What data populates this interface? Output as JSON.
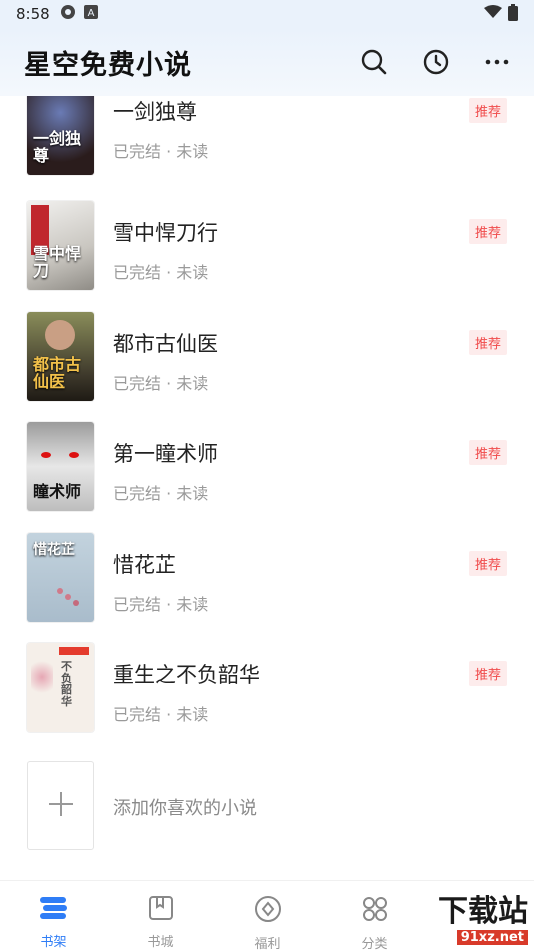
{
  "status_bar": {
    "time": "8:58"
  },
  "header": {
    "title": "星空免费小说"
  },
  "books": [
    {
      "title": "一剑独尊",
      "meta": "已完结 · 未读",
      "badge": "推荐",
      "cover_text": "一剑独尊",
      "cover_color": "#3b2a2a"
    },
    {
      "title": "雪中悍刀行",
      "meta": "已完结 · 未读",
      "badge": "推荐",
      "cover_text": "雪中悍刀",
      "cover_color": "#d8d6d2"
    },
    {
      "title": "都市古仙医",
      "meta": "已完结 · 未读",
      "badge": "推荐",
      "cover_text": "都市古仙医",
      "cover_color": "#5a5444"
    },
    {
      "title": "第一瞳术师",
      "meta": "已完结 · 未读",
      "badge": "推荐",
      "cover_text": "瞳术师",
      "cover_color": "#6b6b6b"
    },
    {
      "title": "惜花芷",
      "meta": "已完结 · 未读",
      "badge": "推荐",
      "cover_text": "惜花芷",
      "cover_color": "#b9cad6"
    },
    {
      "title": "重生之不负韶华",
      "meta": "已完结 · 未读",
      "badge": "推荐",
      "cover_text": "不负韶华",
      "cover_color": "#f3ece6"
    }
  ],
  "add_prompt": "添加你喜欢的小说",
  "tabs": [
    {
      "label": "书架",
      "icon": "bookshelf-icon",
      "active": true
    },
    {
      "label": "书城",
      "icon": "book-store-icon",
      "active": false
    },
    {
      "label": "福利",
      "icon": "welfare-icon",
      "active": false
    },
    {
      "label": "分类",
      "icon": "category-icon",
      "active": false
    }
  ],
  "watermark": {
    "main": "下载站",
    "sub": "91xz.net"
  },
  "colors": {
    "accent": "#2f7df6",
    "badge_text": "#f04a4a",
    "badge_bg": "#fdecec"
  }
}
